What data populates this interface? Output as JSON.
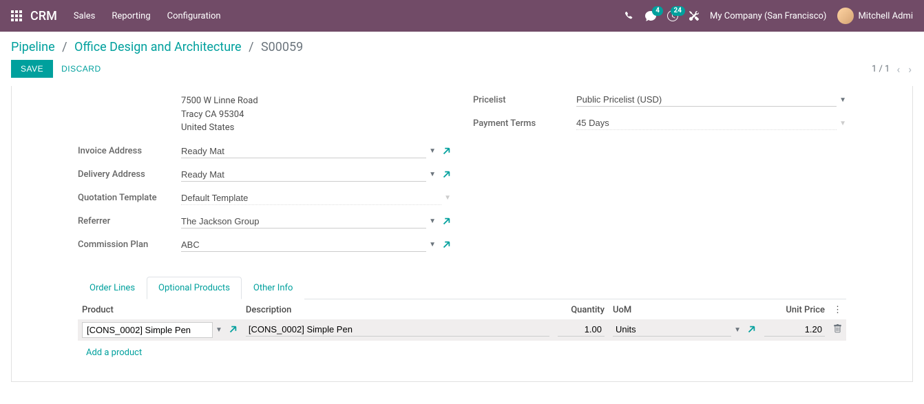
{
  "topbar": {
    "brand": "CRM",
    "menu": [
      "Sales",
      "Reporting",
      "Configuration"
    ],
    "badge_chat": "4",
    "badge_clock": "24",
    "company": "My Company (San Francisco)",
    "user": "Mitchell Admi"
  },
  "breadcrumb": {
    "items": [
      "Pipeline",
      "Office Design and Architecture"
    ],
    "current": "S00059"
  },
  "actions": {
    "save": "SAVE",
    "discard": "DISCARD",
    "pager": "1 / 1"
  },
  "form": {
    "address": [
      "7500 W Linne Road",
      "Tracy CA 95304",
      "United States"
    ],
    "left": [
      {
        "label": "Invoice Address",
        "value": "Ready Mat",
        "dropdown": true,
        "external": true
      },
      {
        "label": "Delivery Address",
        "value": "Ready Mat",
        "dropdown": true,
        "external": true
      },
      {
        "label": "Quotation Template",
        "value": "Default Template",
        "dropdown": true,
        "external": false,
        "readonly": true
      },
      {
        "label": "Referrer",
        "value": "The Jackson Group",
        "dropdown": true,
        "external": true
      },
      {
        "label": "Commission Plan",
        "value": "ABC",
        "dropdown": true,
        "external": true
      }
    ],
    "right": [
      {
        "label": "Pricelist",
        "value": "Public Pricelist (USD)",
        "dropdown": true,
        "external": false
      },
      {
        "label": "Payment Terms",
        "value": "45 Days",
        "dropdown": true,
        "external": false,
        "readonly": true
      }
    ]
  },
  "tabs": [
    "Order Lines",
    "Optional Products",
    "Other Info"
  ],
  "active_tab": 1,
  "table": {
    "headers": [
      "Product",
      "Description",
      "Quantity",
      "UoM",
      "Unit Price"
    ],
    "rows": [
      {
        "product": "[CONS_0002] Simple Pen",
        "description": "[CONS_0002] Simple Pen",
        "quantity": "1.00",
        "uom": "Units",
        "price": "1.20"
      }
    ],
    "add": "Add a product"
  }
}
